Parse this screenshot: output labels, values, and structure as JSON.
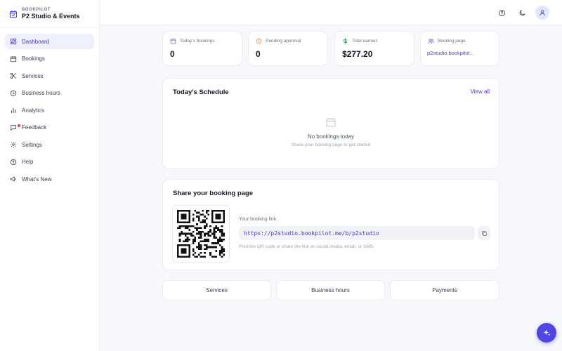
{
  "brand": {
    "kicker": "BOOKPILOT",
    "name": "P2 Studio & Events"
  },
  "sidebar": {
    "items": [
      {
        "label": "Dashboard",
        "icon": "dashboard-icon",
        "active": true
      },
      {
        "label": "Bookings",
        "icon": "calendar-icon"
      },
      {
        "label": "Services",
        "icon": "scissors-icon"
      },
      {
        "label": "Business hours",
        "icon": "clock-icon"
      },
      {
        "label": "Analytics",
        "icon": "bar-chart-icon"
      },
      {
        "label": "Feedback",
        "icon": "message-icon"
      },
      {
        "label": "Settings",
        "icon": "gear-icon"
      },
      {
        "label": "Help",
        "icon": "help-icon"
      },
      {
        "label": "What's New",
        "icon": "megaphone-icon"
      }
    ]
  },
  "header": {
    "icons": [
      "help-icon",
      "moon-icon",
      "user-icon"
    ]
  },
  "stats": [
    {
      "label": "Today's bookings",
      "value": "0",
      "icon": "calendar-icon"
    },
    {
      "label": "Pending approval",
      "value": "0",
      "icon": "clock-icon"
    },
    {
      "label": "Total earned",
      "value": "$277.20",
      "icon": "dollar-icon"
    },
    {
      "label": "Booking page",
      "value": "p2studio.bookpilot...",
      "icon": "users-icon"
    }
  ],
  "schedule": {
    "title": "Today's Schedule",
    "view_all": "View all",
    "empty_title": "No bookings today",
    "empty_sub": "Share your booking page to get started"
  },
  "share": {
    "title": "Share your booking page",
    "link_label": "Your booking link",
    "link": "https://p2studio.bookpilot.me/b/p2studio",
    "hint": "Print the QR code or share the link on social media, email, or SMS."
  },
  "quick_links": [
    "Services",
    "Business hours",
    "Payments"
  ],
  "colors": {
    "accent": "#4f46e5",
    "active_bg": "#eef0fd",
    "green": "#16a34a",
    "orange": "#f97316"
  }
}
